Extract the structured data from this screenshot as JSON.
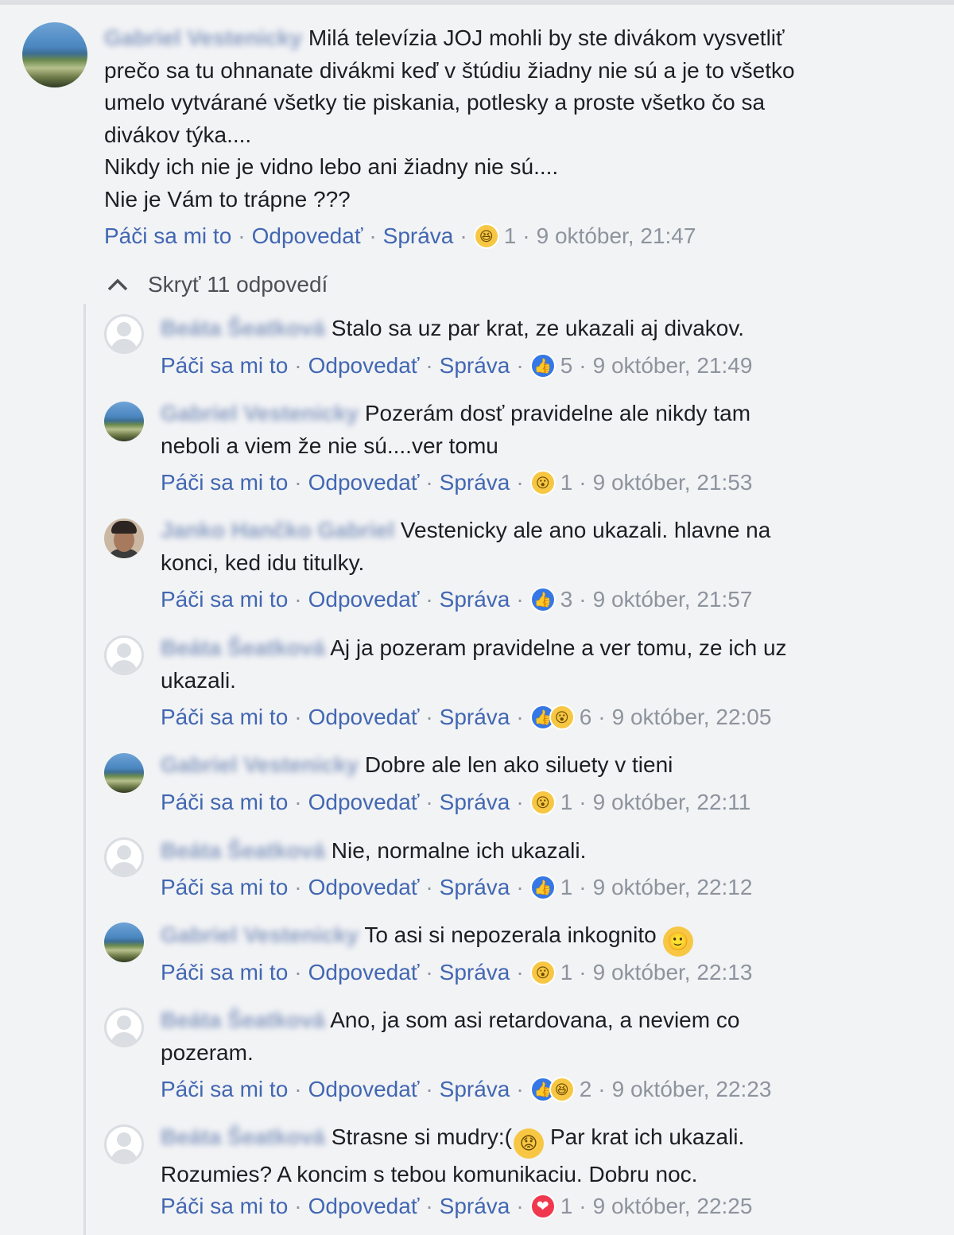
{
  "main_comment": {
    "author": "Gabriel Vestenicky",
    "text_lines": [
      "Milá televízia JOJ mohli by ste divákom vysvetliť",
      "prečo sa tu ohnanate divákmi keď v štúdiu žiadny nie sú a je to všetko",
      "umelo vytvárané všetky tie piskania, potlesky a proste všetko čo sa",
      "divákov týka....",
      "Nikdy ich nie je vidno lebo ani žiadny nie sú....",
      "Nie je Vám to trápne ???"
    ],
    "actions": {
      "like": "Páči sa mi to",
      "reply": "Odpovedať",
      "message": "Správa"
    },
    "reaction_icon": "haha-emoji-icon",
    "reaction_count": "1",
    "timestamp": "9 október, 21:47"
  },
  "replies_toggle": {
    "label": "Skryť 11 odpovedí",
    "icon": "chevron-up-icon"
  },
  "separator": "·",
  "replies": [
    {
      "author": "Beáta Šeatková",
      "line1": "Stalo sa uz par krat, ze ukazali aj divakov.",
      "line2": "",
      "like": "Páči sa mi to",
      "reply": "Odpovedať",
      "message": "Správa",
      "reactions": [
        "like"
      ],
      "count": "5",
      "time": "9 október, 21:49"
    },
    {
      "author": "Gabriel Vestenicky",
      "line1": "Pozerám dosť pravidelne ale nikdy tam",
      "line2": "neboli a viem že nie sú....ver tomu",
      "like": "Páči sa mi to",
      "reply": "Odpovedať",
      "message": "Správa",
      "reactions": [
        "wow"
      ],
      "count": "1",
      "time": "9 október, 21:53"
    },
    {
      "author": "Janko Hančko Gabriel",
      "line1": "Vestenicky ale ano ukazali. hlavne na",
      "line2": "konci, ked idu titulky.",
      "like": "Páči sa mi to",
      "reply": "Odpovedať",
      "message": "Správa",
      "reactions": [
        "like"
      ],
      "count": "3",
      "time": "9 október, 21:57"
    },
    {
      "author": "Beáta Šeatková",
      "line1": "Aj ja pozeram pravidelne a ver tomu, ze ich uz",
      "line2": "ukazali.",
      "like": "Páči sa mi to",
      "reply": "Odpovedať",
      "message": "Správa",
      "reactions": [
        "like",
        "wow"
      ],
      "count": "6",
      "time": "9 október, 22:05"
    },
    {
      "author": "Gabriel Vestenicky",
      "line1": "Dobre ale len ako siluety v tieni",
      "line2": "",
      "like": "Páči sa mi to",
      "reply": "Odpovedať",
      "message": "Správa",
      "reactions": [
        "wow"
      ],
      "count": "1",
      "time": "9 október, 22:11"
    },
    {
      "author": "Beáta Šeatková",
      "line1": "Nie, normalne ich ukazali.",
      "line2": "",
      "like": "Páči sa mi to",
      "reply": "Odpovedať",
      "message": "Správa",
      "reactions": [
        "like"
      ],
      "count": "1",
      "time": "9 október, 22:12"
    },
    {
      "author": "Gabriel Vestenicky",
      "line1": "To asi si nepozerala inkognito",
      "line2": "",
      "like": "Páči sa mi to",
      "reply": "Odpovedať",
      "message": "Správa",
      "reactions": [
        "wow"
      ],
      "count": "1",
      "time": "9 október, 22:13"
    },
    {
      "author": "Beáta Šeatková",
      "line1": "Ano, ja som asi retardovana, a neviem co",
      "line2": "pozeram.",
      "like": "Páči sa mi to",
      "reply": "Odpovedať",
      "message": "Správa",
      "reactions": [
        "like",
        "haha"
      ],
      "count": "2",
      "time": "9 október, 22:23"
    },
    {
      "author": "Beáta Šeatková",
      "line1": "Strasne si mudry:(",
      "line1b": "Par krat ich ukazali.",
      "line2": "Rozumies? A koncim s tebou komunikaciu. Dobru noc.",
      "like": "Páči sa mi to",
      "reply": "Odpovedať",
      "message": "Správa",
      "reactions": [
        "love"
      ],
      "count": "1",
      "time": "9 október, 22:25"
    }
  ],
  "emoji_glyphs": {
    "like": "👍",
    "haha": "😆",
    "wow": "😮",
    "love": "❤",
    "sad": "😟",
    "smile": "🙂"
  }
}
